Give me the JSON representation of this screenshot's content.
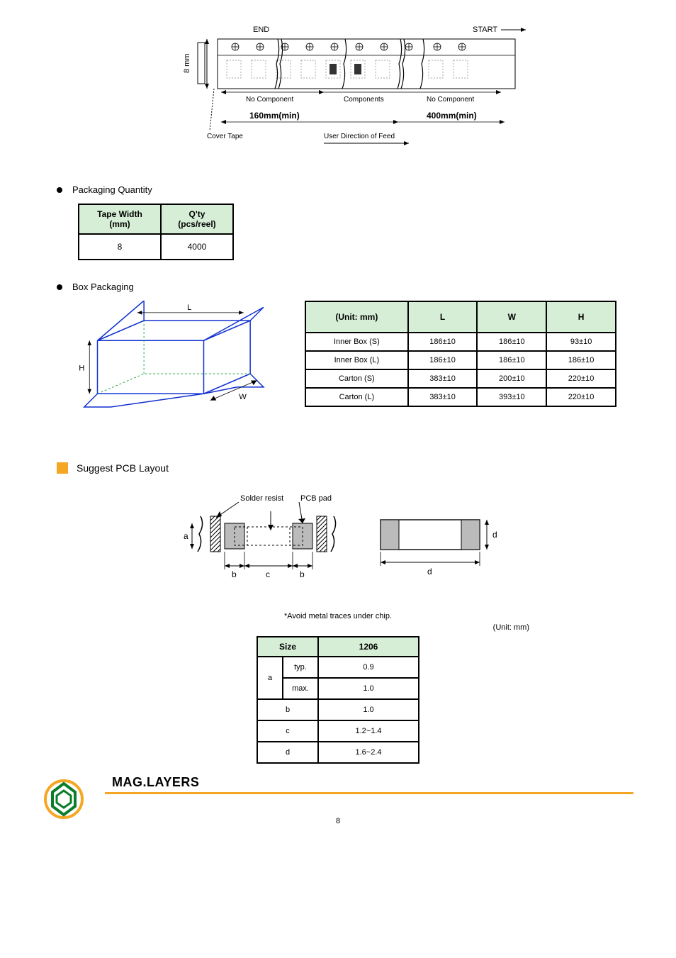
{
  "tape": {
    "end_label": "END",
    "start_label": "START",
    "width_label": "8 mm",
    "nocomp1": "No Component",
    "components": "Components",
    "nocomp2": "No Component",
    "len1": "160mm(min)",
    "len2": "400mm(min)",
    "cover": "Cover Tape",
    "feed": "User Direction of Feed"
  },
  "section_qty": "Packaging Quantity",
  "qty_table": {
    "h1": "Tape Width\n(mm)",
    "h2": "Q'ty\n(pcs/reel)",
    "r1c1": "8",
    "r1c2": "4000"
  },
  "section_box": "Box Packaging",
  "box_labels": {
    "L": "L",
    "W": "W",
    "H": "H"
  },
  "box_table": {
    "h1": "(Unit: mm)",
    "h2": "L",
    "h3": "W",
    "h4": "H",
    "rows": [
      {
        "name": "Inner Box (S)",
        "l": "186±10",
        "w": "186±10",
        "h": "93±10"
      },
      {
        "name": "Inner Box (L)",
        "l": "186±10",
        "w": "186±10",
        "h": "186±10"
      },
      {
        "name": "Carton (S)",
        "l": "383±10",
        "w": "200±10",
        "h": "220±10"
      },
      {
        "name": "Carton (L)",
        "l": "383±10",
        "w": "393±10",
        "h": "220±10"
      }
    ]
  },
  "pcb_title": "Suggest PCB Layout",
  "pcb_labels": {
    "solder": "Solder resist",
    "pad": "PCB pad",
    "a": "a",
    "b": "b",
    "c": "c",
    "d1": "d",
    "d2": "d"
  },
  "pcb_note": "*Avoid metal traces under chip.",
  "pcb_note2": "(Unit: mm)",
  "pcb_table": {
    "h1": "Size",
    "h2": "1206",
    "rows": [
      {
        "name": "typ.",
        "val": "0.9",
        "merge": "a"
      },
      {
        "name": "max.",
        "val": "1.0"
      },
      {
        "name_simple": "b",
        "val": "1.0"
      },
      {
        "name_simple": "c",
        "val": "1.2~1.4"
      },
      {
        "name_simple": "d",
        "val": "1.6~2.4"
      }
    ]
  },
  "footer_company": "MAG.LAYERS",
  "page": "8"
}
